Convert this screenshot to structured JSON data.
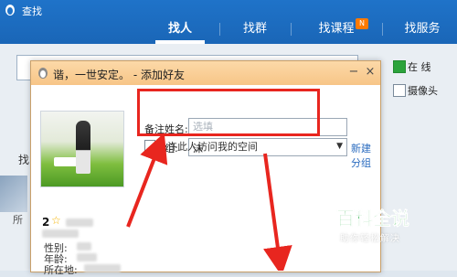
{
  "app": {
    "title": "查找",
    "tabs": [
      {
        "label": "找人",
        "active": true
      },
      {
        "label": "找群",
        "active": false
      },
      {
        "label": "找课程",
        "active": false,
        "badge": "N"
      },
      {
        "label": "找服务",
        "active": false
      }
    ],
    "search_value": "",
    "options": [
      {
        "label": "在 线",
        "checked": true
      },
      {
        "label": "摄像头",
        "checked": false
      }
    ],
    "left_fragment": "找",
    "left_fragment2": "所"
  },
  "dialog": {
    "title": "谐，一世安定。 - 添加好友",
    "minimize_glyph": "−",
    "close_glyph": "×",
    "profile": {
      "level_number": "2",
      "star_glyph": "☆",
      "gender_label": "性别:",
      "age_label": "年龄:",
      "location_label": "所在地:"
    },
    "remark": {
      "label": "备注姓名:",
      "placeholder": "选填",
      "value": ""
    },
    "group": {
      "label": "分　组:",
      "selected": "沫",
      "arrow_glyph": "▼",
      "new_group_link": "新建分组"
    },
    "allow_visit": {
      "label": "允许此人访问我的空间",
      "checked": false
    }
  },
  "watermark": {
    "brand": "百科全说",
    "tagline": "助你轻松解决"
  },
  "colors": {
    "topbar": "#1f73c9",
    "dialog_title": "#f7c587",
    "highlight_red": "#e8261f",
    "link_blue": "#2a6bbf",
    "watermark_green": "#2fb24a"
  }
}
